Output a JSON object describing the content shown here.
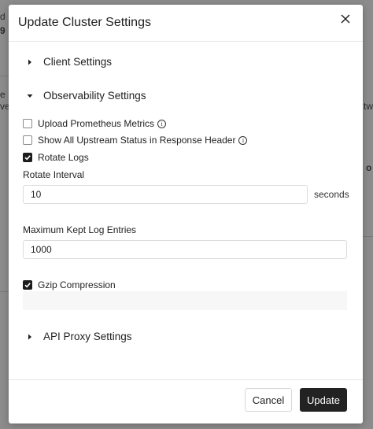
{
  "background": {
    "fragments": [
      "d 1",
      "9",
      "e",
      "ve",
      "twi",
      "o"
    ]
  },
  "modal": {
    "title": "Update Cluster Settings",
    "close_icon": "close-icon"
  },
  "sections": {
    "client": {
      "label": "Client Settings",
      "expanded": false
    },
    "observability": {
      "label": "Observability Settings",
      "expanded": true
    },
    "api_proxy": {
      "label": "API Proxy Settings",
      "expanded": false
    }
  },
  "observability": {
    "upload_prometheus": {
      "label": "Upload Prometheus Metrics",
      "checked": false,
      "info_icon": "info-icon"
    },
    "show_upstream": {
      "label": "Show All Upstream Status in Response Header",
      "checked": false,
      "info_icon": "info-icon"
    },
    "rotate_logs": {
      "label": "Rotate Logs",
      "checked": true
    },
    "rotate_interval": {
      "label": "Rotate Interval",
      "value": "10",
      "unit": "seconds"
    },
    "max_log_entries": {
      "label": "Maximum Kept Log Entries",
      "value": "1000"
    },
    "gzip": {
      "label": "Gzip Compression",
      "checked": true
    }
  },
  "footer": {
    "cancel_label": "Cancel",
    "update_label": "Update"
  },
  "colors": {
    "primary_button": "#222222",
    "overlay": "#8c8c8c",
    "border": "#dcdcdc"
  }
}
